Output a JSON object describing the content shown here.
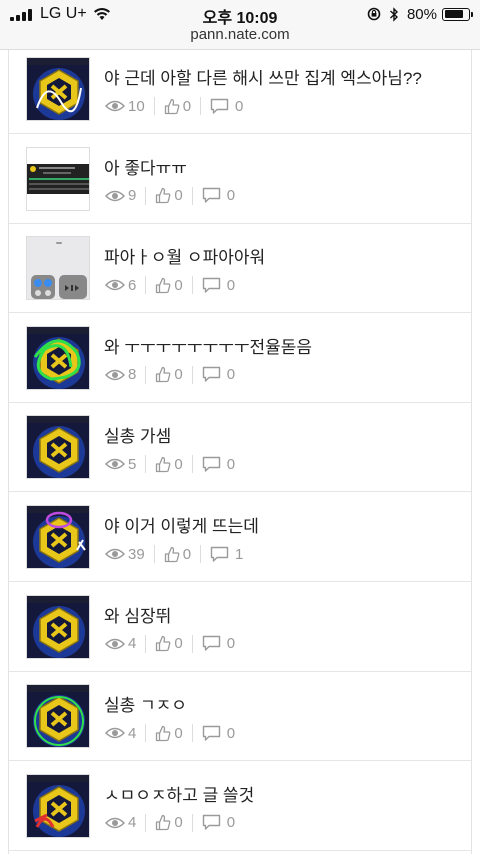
{
  "status_bar": {
    "carrier": "LG U+",
    "time": "오후 10:09",
    "battery_percent": "80%",
    "battery_level": 0.8
  },
  "browser": {
    "url": "pann.nate.com"
  },
  "posts": [
    {
      "title": "야 근데 아할 다른 해시 쓰만 집계 엑스아님??",
      "views": "10",
      "likes": "0",
      "comments": "0",
      "thumbnail": "exo-logo-dark-blue"
    },
    {
      "title": "아 좋다ㅠㅠ",
      "views": "9",
      "likes": "0",
      "comments": "0",
      "thumbnail": "music-app-screen"
    },
    {
      "title": "파아ㅏㅇ월 ㅇ파아아워",
      "views": "6",
      "likes": "0",
      "comments": "0",
      "thumbnail": "control-center"
    },
    {
      "title": "와 ㅜㅜㅜㅜㅜㅜㅜㅜ전율돋음",
      "views": "8",
      "likes": "0",
      "comments": "0",
      "thumbnail": "exo-logo-green-scribble"
    },
    {
      "title": "실총 가셈",
      "views": "5",
      "likes": "0",
      "comments": "0",
      "thumbnail": "exo-logo"
    },
    {
      "title": "야 이거 이렇게 뜨는데",
      "views": "39",
      "likes": "0",
      "comments": "1",
      "thumbnail": "exo-logo-purple-circle"
    },
    {
      "title": "와 심장뛰",
      "views": "4",
      "likes": "0",
      "comments": "0",
      "thumbnail": "exo-logo"
    },
    {
      "title": "실총 ㄱㅈㅇ",
      "views": "4",
      "likes": "0",
      "comments": "0",
      "thumbnail": "exo-logo-green-ring"
    },
    {
      "title": "ㅅㅁㅇㅈ하고 글 쓸것",
      "views": "4",
      "likes": "0",
      "comments": "0",
      "thumbnail": "exo-logo-red-mark"
    }
  ],
  "colors": {
    "meta_text": "#9a9a9a",
    "divider": "#e6e6e6",
    "thumb_dark_blue": "#14183a",
    "exo_gold": "#e8c71a"
  }
}
